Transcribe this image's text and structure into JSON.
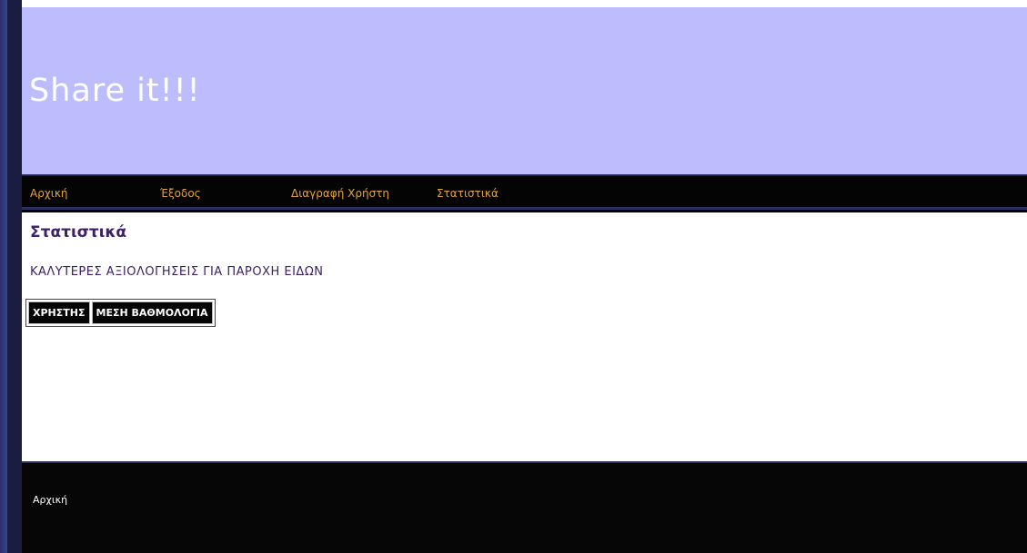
{
  "header": {
    "site_title": "Share it!!!"
  },
  "nav": {
    "items": [
      {
        "label": "Αρχική"
      },
      {
        "label": "Έξοδος"
      },
      {
        "label": "Διαγραφή Χρήστη"
      },
      {
        "label": "Στατιστικά"
      }
    ]
  },
  "main": {
    "page_heading": "Στατιστικά",
    "section_heading": "ΚΑΛΥΤΕΡΕΣ ΑΞΙΟΛΟΓΗΣΕΙΣ ΓΙΑ ΠΑΡΟΧΗ ΕΙΔΩΝ",
    "table": {
      "columns": [
        "ΧΡΗΣΤΗΣ",
        "ΜΕΣΗ ΒΑΘΜΟΛΟΓΙΑ"
      ],
      "rows": []
    }
  },
  "footer": {
    "link_label": "Αρχική"
  },
  "colors": {
    "header_bg": "#bdbdfd",
    "nav_bg": "#040404",
    "nav_link": "#e3a43c",
    "heading_text": "#3d2068",
    "footer_bg": "#060606"
  }
}
